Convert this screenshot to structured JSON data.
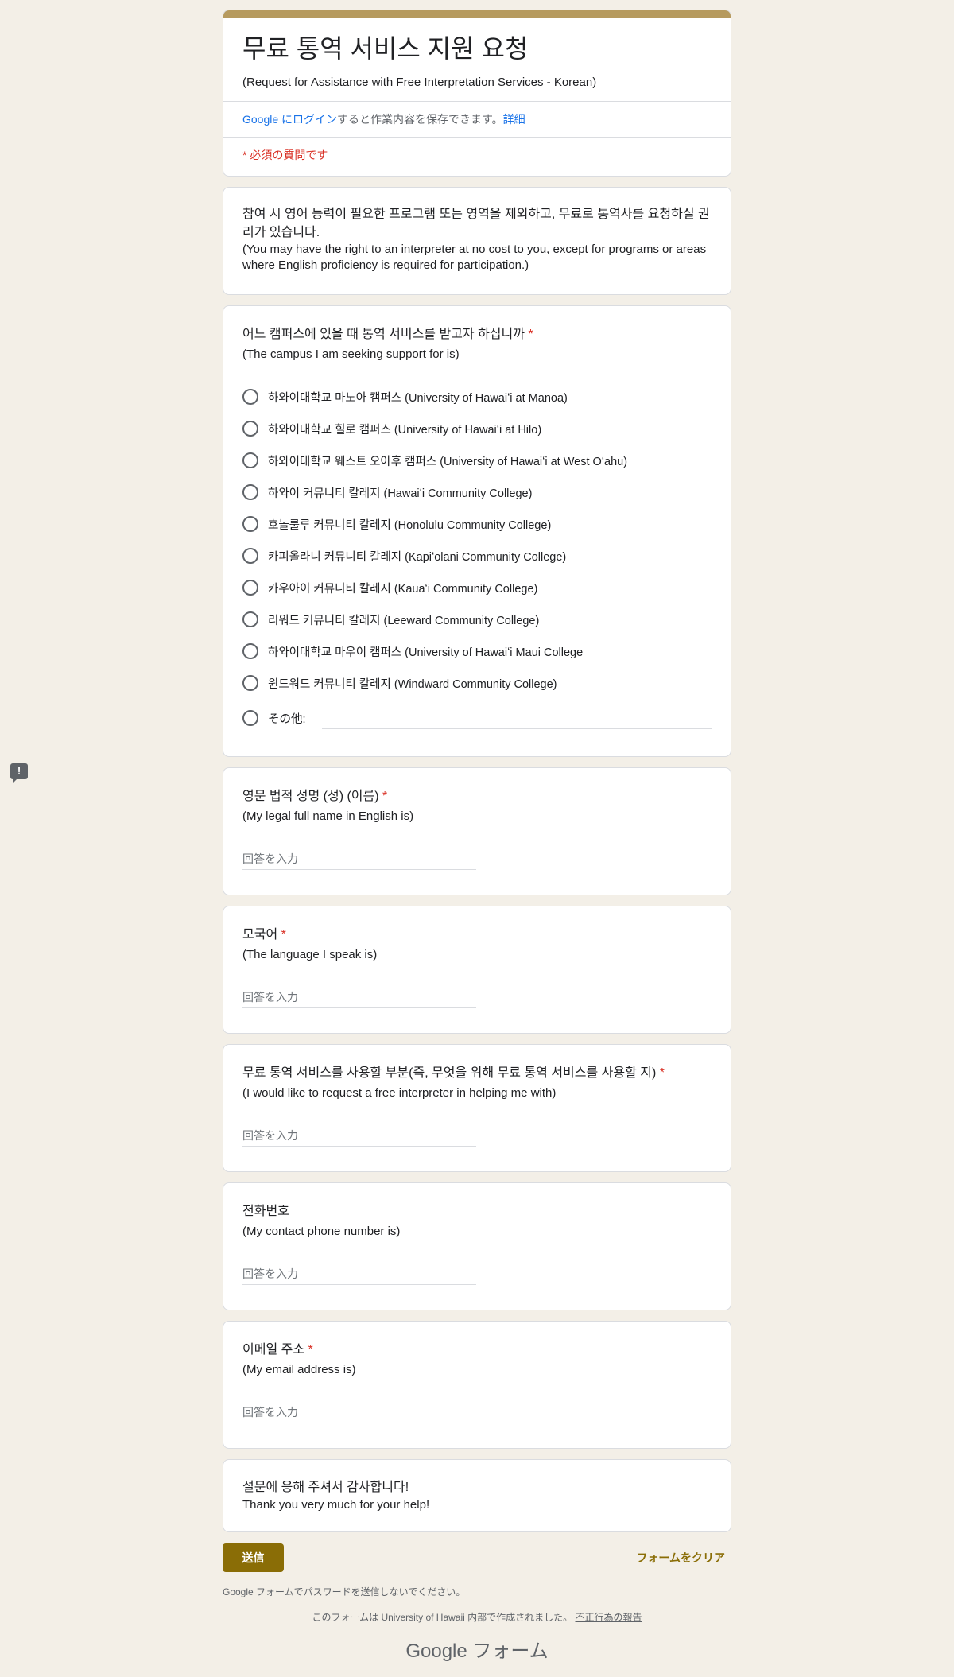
{
  "header": {
    "title": "무료 통역 서비스 지원 요청",
    "subtitle": "(Request for Assistance with Free Interpretation Services - Korean)",
    "login_link": "Google にログイン",
    "login_text": "すると作業内容を保存できます。",
    "details_link": "詳細",
    "required_note": "* 必須の質問です"
  },
  "description": {
    "korean": "참여 시 영어 능력이 필요한 프로그램  또는 영역을 제외하고, 무료로 통역사를 요청하실 권리가 있습니다.",
    "english": "(You may have the right to an interpreter at no cost to you, except for programs or areas where English proficiency is required for participation.)"
  },
  "campus_question": {
    "title": "어느 캠퍼스에 있을 때 통역 서비스를 받고자 하십니까",
    "required_mark": "*",
    "subtitle": "(The campus I am seeking support for is)",
    "options": [
      "하와이대학교 마노아 캠퍼스 (University of Hawaiʻi at Mānoa)",
      "하와이대학교 힐로 캠퍼스 (University of Hawaiʻi at Hilo)",
      "하와이대학교 웨스트 오아후 캠퍼스 (University of Hawaiʻi at West Oʻahu)",
      "하와이 커뮤니티 칼레지 (Hawaiʻi Community College)",
      "호놀룰루 커뮤니티 칼레지 (Honolulu Community College)",
      "카피올라니 커뮤니티 칼레지 (Kapiʻolani Community College)",
      "카우아이 커뮤니티 칼레지 (Kauaʻi Community College)",
      "리워드 커뮤니티 칼레지 (Leeward Community College)",
      "하와이대학교 마우이 캠퍼스 (University of Hawaiʻi Maui College",
      "윈드워드 커뮤니티 칼레지 (Windward Community College)"
    ],
    "other_label": "その他:"
  },
  "name_question": {
    "title": "영문 법적 성명 (성) (이름)",
    "required_mark": "*",
    "subtitle": "(My legal full name in English is)",
    "placeholder": "回答を入力"
  },
  "language_question": {
    "title": "모국어",
    "required_mark": "*",
    "subtitle": "(The language I speak is)",
    "placeholder": "回答を入力"
  },
  "purpose_question": {
    "title": "무료 통역 서비스를 사용할 부분(즉, 무엇을 위해 무료 통역 서비스를 사용할 지)",
    "required_mark": "*",
    "subtitle": "(I would like to request a free interpreter in helping me with)",
    "placeholder": "回答を入力"
  },
  "phone_question": {
    "title": "전화번호",
    "subtitle": "(My contact phone number is)",
    "placeholder": "回答を入力"
  },
  "email_question": {
    "title": "이메일 주소",
    "required_mark": "*",
    "subtitle": "(My email address is)",
    "placeholder": "回答を入力"
  },
  "thanks": {
    "korean": "설문에 응해 주셔서 감사합니다!",
    "english": "Thank you very much for your help!"
  },
  "actions": {
    "submit_label": "送信",
    "clear_label": "フォームをクリア"
  },
  "footer": {
    "password_note": "Google フォームでパスワードを送信しないでください。",
    "made_by": "このフォームは University of Hawaii 内部で作成されました。",
    "report_link": "不正行為の報告",
    "brand": "Google フォーム"
  },
  "feedback_icon": "report-feedback-icon"
}
